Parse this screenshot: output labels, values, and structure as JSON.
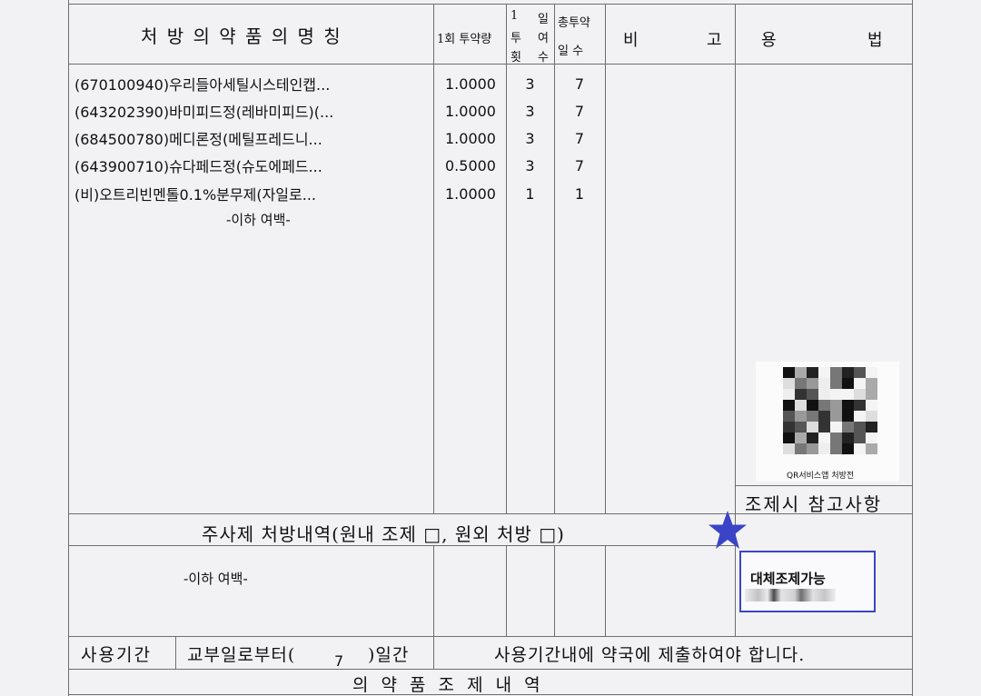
{
  "header": {
    "drug_name": "처 방  의 약 품 의  명 칭",
    "dose_once": "1회 투약량",
    "daily_freq_a": "1",
    "daily_freq_b": "투",
    "daily_freq_c": "횟",
    "daily_freq_d": "일",
    "daily_freq_e": "여",
    "daily_freq_f": "수",
    "total_days_a": "총투약",
    "total_days_b": "일  수",
    "remarks_a": "비",
    "remarks_b": "고",
    "usage_a": "용",
    "usage_b": "법"
  },
  "drugs": [
    {
      "name": "(670100940)우리들아세틸시스테인캡...",
      "dose": "1.0000",
      "freq": "3",
      "days": "7"
    },
    {
      "name": "(643202390)바미피드정(레바미피드)(...",
      "dose": "1.0000",
      "freq": "3",
      "days": "7"
    },
    {
      "name": "(684500780)메디론정(메틸프레드니...",
      "dose": "1.0000",
      "freq": "3",
      "days": "7"
    },
    {
      "name": "(643900710)슈다페드정(슈도에페드...",
      "dose": "0.5000",
      "freq": "3",
      "days": "7"
    },
    {
      "name": "(비)오트리빈멘톨0.1%분무제(자일로...",
      "dose": "1.0000",
      "freq": "1",
      "days": "1"
    }
  ],
  "blank_note_1": "-이하 여백-",
  "qr_caption": "QR서비스앱 처방전",
  "prep_note_title": "조제시 참고사항",
  "injection_title": "주사제 처방내역(원내 조제 □, 원외 처방 □)",
  "blank_note_2": "-이하 여백-",
  "substitution_label": "대체조제가능",
  "period_label": "사용기간",
  "period_from": "교부일로부터(",
  "period_days": "7",
  "period_to": ")일간",
  "period_notice": "사용기간내에 약국에 제출하여야 합니다.",
  "bottom_title": "의  약  품    조  제  내  역",
  "colors": {
    "stamp_border": "#3c45c7",
    "star": "#3b44c6"
  }
}
